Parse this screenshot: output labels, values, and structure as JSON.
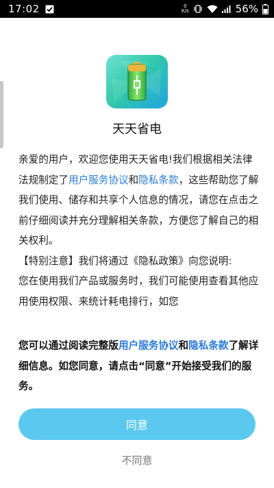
{
  "status_bar": {
    "time": "17:02",
    "net_speed_value": "0",
    "net_speed_unit": "K/s",
    "battery_percent": "56%"
  },
  "app": {
    "name": "天天省电",
    "icon": "battery-charging-icon"
  },
  "content": {
    "para1_prefix": "亲爱的用户，欢迎您使用天天省电!我们根据相关法律法规制定了",
    "para1_link1": "用户服务协议",
    "para1_and": "和",
    "para1_link2": "隐私条款",
    "para1_suffix": "，这些帮助您了解我们使用、储存和共享个人信息的情况，请您在点击之前仔细阅读并充分理解相关条款，方便您了解自己的相关权利。",
    "para2": "【特别注意】我们将通过《隐私政策》向您说明:",
    "para3": " 您在使用我们产品或服务时，我们可能使用查看其他应用使用权限、来统计耗电排行，如您"
  },
  "summary": {
    "prefix": "您可以通过阅读完整版",
    "link1": "用户服务协议",
    "and": "和",
    "link2": "隐私条款",
    "suffix": "了解详细信息。如您同意，请点击“同意”开始接受我们的服务。"
  },
  "buttons": {
    "agree": "同意",
    "disagree": "不同意"
  },
  "colors": {
    "link": "#2a7bd8",
    "agree_button": "#5bc8ef"
  }
}
